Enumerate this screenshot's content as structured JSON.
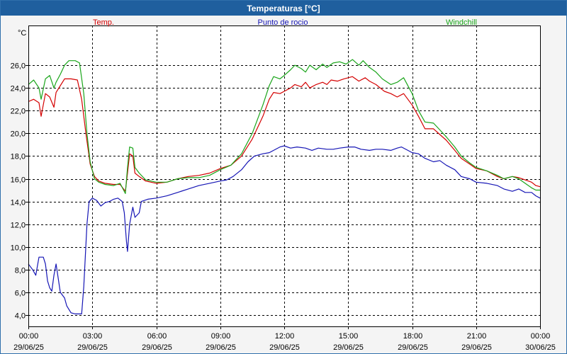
{
  "window": {
    "title": "Temperaturas [°C]"
  },
  "chart_data": {
    "type": "line",
    "title": "Temperaturas [°C]",
    "ylabel": "°C",
    "xlabel": "",
    "ylim": [
      3,
      29.5
    ],
    "yticks": [
      4,
      6,
      8,
      10,
      12,
      14,
      16,
      18,
      20,
      22,
      24,
      26
    ],
    "ytick_labels": [
      "4,0",
      "6,0",
      "8,0",
      "10,0",
      "12,0",
      "14,0",
      "16,0",
      "18,0",
      "20,0",
      "22,0",
      "24,0",
      "26,0"
    ],
    "xlim": [
      0,
      24
    ],
    "xticks": [
      0,
      3,
      6,
      9,
      12,
      15,
      18,
      21,
      24
    ],
    "xtick_labels": [
      {
        "time": "00:00",
        "date": "29/06/25"
      },
      {
        "time": "03:00",
        "date": "29/06/25"
      },
      {
        "time": "06:00",
        "date": "29/06/25"
      },
      {
        "time": "09:00",
        "date": "29/06/25"
      },
      {
        "time": "12:00",
        "date": "29/06/25"
      },
      {
        "time": "15:00",
        "date": "29/06/25"
      },
      {
        "time": "18:00",
        "date": "29/06/25"
      },
      {
        "time": "21:00",
        "date": "29/06/25"
      },
      {
        "time": "00:00",
        "date": "30/06/25"
      }
    ],
    "grid": true,
    "legend_position": "top",
    "x_unit": "hours",
    "series": [
      {
        "name": "Temp.",
        "color": "#d40000",
        "points": [
          [
            0,
            22.8
          ],
          [
            0.25,
            23.0
          ],
          [
            0.5,
            22.7
          ],
          [
            0.6,
            21.5
          ],
          [
            0.8,
            23.5
          ],
          [
            1.0,
            23.2
          ],
          [
            1.2,
            22.3
          ],
          [
            1.3,
            23.6
          ],
          [
            1.5,
            24.2
          ],
          [
            1.7,
            24.8
          ],
          [
            2.0,
            24.8
          ],
          [
            2.3,
            24.7
          ],
          [
            2.5,
            23.0
          ],
          [
            2.7,
            20.0
          ],
          [
            2.9,
            17.3
          ],
          [
            3.1,
            16.2
          ],
          [
            3.3,
            15.8
          ],
          [
            3.6,
            15.6
          ],
          [
            4.0,
            15.5
          ],
          [
            4.3,
            15.5
          ],
          [
            4.55,
            14.9
          ],
          [
            4.65,
            16.5
          ],
          [
            4.75,
            18.2
          ],
          [
            4.9,
            18.0
          ],
          [
            5.0,
            16.5
          ],
          [
            5.2,
            16.2
          ],
          [
            5.5,
            15.8
          ],
          [
            6.0,
            15.6
          ],
          [
            6.5,
            15.7
          ],
          [
            7.0,
            16.0
          ],
          [
            7.5,
            16.2
          ],
          [
            8.0,
            16.3
          ],
          [
            8.5,
            16.5
          ],
          [
            9.0,
            16.9
          ],
          [
            9.5,
            17.2
          ],
          [
            10.0,
            18.0
          ],
          [
            10.5,
            19.5
          ],
          [
            11.0,
            21.5
          ],
          [
            11.3,
            23.0
          ],
          [
            11.5,
            23.6
          ],
          [
            11.8,
            23.5
          ],
          [
            12.0,
            23.7
          ],
          [
            12.3,
            24.0
          ],
          [
            12.5,
            24.3
          ],
          [
            12.8,
            24.1
          ],
          [
            13.0,
            24.5
          ],
          [
            13.2,
            24.0
          ],
          [
            13.5,
            24.3
          ],
          [
            13.8,
            24.5
          ],
          [
            14.0,
            24.3
          ],
          [
            14.2,
            24.7
          ],
          [
            14.5,
            24.6
          ],
          [
            14.8,
            24.8
          ],
          [
            15.0,
            24.9
          ],
          [
            15.2,
            25.0
          ],
          [
            15.5,
            24.6
          ],
          [
            15.8,
            24.9
          ],
          [
            16.0,
            24.6
          ],
          [
            16.3,
            24.3
          ],
          [
            16.7,
            23.7
          ],
          [
            17.0,
            23.5
          ],
          [
            17.3,
            23.2
          ],
          [
            17.6,
            23.5
          ],
          [
            18.0,
            22.5
          ],
          [
            18.3,
            21.5
          ],
          [
            18.6,
            20.4
          ],
          [
            19.0,
            20.4
          ],
          [
            19.3,
            19.9
          ],
          [
            19.6,
            19.4
          ],
          [
            20.0,
            18.5
          ],
          [
            20.3,
            17.8
          ],
          [
            20.7,
            17.3
          ],
          [
            21.0,
            16.9
          ],
          [
            21.5,
            16.7
          ],
          [
            22.0,
            16.2
          ],
          [
            22.3,
            16.0
          ],
          [
            22.7,
            16.2
          ],
          [
            23.0,
            16.1
          ],
          [
            23.3,
            15.9
          ],
          [
            23.6,
            15.7
          ],
          [
            23.8,
            15.4
          ],
          [
            24.0,
            15.3
          ]
        ]
      },
      {
        "name": "Punto de rocio",
        "color": "#1515b5",
        "points": [
          [
            0,
            8.5
          ],
          [
            0.2,
            8.0
          ],
          [
            0.35,
            7.5
          ],
          [
            0.5,
            9.1
          ],
          [
            0.7,
            9.1
          ],
          [
            0.8,
            8.5
          ],
          [
            0.9,
            7.0
          ],
          [
            1.0,
            6.4
          ],
          [
            1.1,
            6.1
          ],
          [
            1.2,
            7.5
          ],
          [
            1.3,
            8.5
          ],
          [
            1.5,
            6.0
          ],
          [
            1.7,
            5.5
          ],
          [
            1.8,
            4.8
          ],
          [
            2.0,
            4.2
          ],
          [
            2.2,
            4.1
          ],
          [
            2.5,
            4.1
          ],
          [
            2.6,
            6.5
          ],
          [
            2.75,
            12.0
          ],
          [
            2.85,
            14.0
          ],
          [
            3.0,
            14.3
          ],
          [
            3.2,
            14.1
          ],
          [
            3.4,
            13.6
          ],
          [
            3.6,
            13.9
          ],
          [
            3.8,
            14.0
          ],
          [
            4.0,
            14.2
          ],
          [
            4.2,
            14.3
          ],
          [
            4.4,
            14.0
          ],
          [
            4.5,
            13.0
          ],
          [
            4.6,
            10.5
          ],
          [
            4.65,
            9.6
          ],
          [
            4.75,
            12.0
          ],
          [
            4.9,
            13.5
          ],
          [
            5.0,
            12.6
          ],
          [
            5.2,
            13.0
          ],
          [
            5.3,
            14.0
          ],
          [
            5.6,
            14.2
          ],
          [
            6.0,
            14.3
          ],
          [
            6.5,
            14.5
          ],
          [
            7.0,
            14.8
          ],
          [
            7.5,
            15.1
          ],
          [
            8.0,
            15.4
          ],
          [
            8.5,
            15.6
          ],
          [
            9.0,
            15.8
          ],
          [
            9.3,
            15.9
          ],
          [
            9.6,
            16.2
          ],
          [
            10.0,
            16.8
          ],
          [
            10.3,
            17.5
          ],
          [
            10.6,
            18.0
          ],
          [
            11.0,
            18.2
          ],
          [
            11.3,
            18.3
          ],
          [
            11.5,
            18.5
          ],
          [
            11.8,
            18.8
          ],
          [
            12.0,
            18.9
          ],
          [
            12.3,
            18.7
          ],
          [
            12.6,
            18.8
          ],
          [
            13.0,
            18.7
          ],
          [
            13.3,
            18.5
          ],
          [
            13.6,
            18.7
          ],
          [
            14.0,
            18.6
          ],
          [
            14.3,
            18.6
          ],
          [
            14.6,
            18.7
          ],
          [
            15.0,
            18.8
          ],
          [
            15.3,
            18.8
          ],
          [
            15.6,
            18.6
          ],
          [
            16.0,
            18.5
          ],
          [
            16.3,
            18.6
          ],
          [
            16.6,
            18.6
          ],
          [
            17.0,
            18.5
          ],
          [
            17.3,
            18.7
          ],
          [
            17.5,
            18.8
          ],
          [
            17.8,
            18.5
          ],
          [
            18.0,
            18.3
          ],
          [
            18.3,
            18.2
          ],
          [
            18.6,
            17.8
          ],
          [
            19.0,
            17.5
          ],
          [
            19.3,
            17.6
          ],
          [
            19.6,
            17.2
          ],
          [
            20.0,
            16.8
          ],
          [
            20.3,
            16.2
          ],
          [
            20.7,
            16.0
          ],
          [
            21.0,
            15.7
          ],
          [
            21.5,
            15.6
          ],
          [
            22.0,
            15.4
          ],
          [
            22.3,
            15.1
          ],
          [
            22.7,
            14.9
          ],
          [
            23.0,
            15.1
          ],
          [
            23.3,
            14.8
          ],
          [
            23.6,
            14.8
          ],
          [
            23.8,
            14.5
          ],
          [
            24.0,
            14.3
          ]
        ]
      },
      {
        "name": "Windchill",
        "color": "#1aa51a",
        "points": [
          [
            0,
            24.3
          ],
          [
            0.25,
            24.7
          ],
          [
            0.5,
            24.0
          ],
          [
            0.6,
            23.0
          ],
          [
            0.8,
            24.8
          ],
          [
            1.0,
            25.1
          ],
          [
            1.2,
            24.0
          ],
          [
            1.3,
            24.5
          ],
          [
            1.5,
            25.2
          ],
          [
            1.7,
            26.0
          ],
          [
            1.9,
            26.4
          ],
          [
            2.2,
            26.4
          ],
          [
            2.4,
            26.2
          ],
          [
            2.6,
            23.5
          ],
          [
            2.75,
            20.0
          ],
          [
            2.9,
            17.5
          ],
          [
            3.1,
            16.0
          ],
          [
            3.3,
            15.7
          ],
          [
            3.6,
            15.5
          ],
          [
            4.0,
            15.4
          ],
          [
            4.3,
            15.6
          ],
          [
            4.55,
            14.7
          ],
          [
            4.65,
            17.0
          ],
          [
            4.75,
            18.8
          ],
          [
            4.9,
            18.7
          ],
          [
            5.0,
            17.0
          ],
          [
            5.2,
            16.5
          ],
          [
            5.5,
            15.9
          ],
          [
            6.0,
            15.7
          ],
          [
            6.5,
            15.7
          ],
          [
            7.0,
            16.0
          ],
          [
            7.5,
            16.1
          ],
          [
            8.0,
            16.1
          ],
          [
            8.5,
            16.3
          ],
          [
            9.0,
            16.8
          ],
          [
            9.5,
            17.2
          ],
          [
            10.0,
            18.2
          ],
          [
            10.5,
            20.0
          ],
          [
            11.0,
            22.5
          ],
          [
            11.3,
            24.2
          ],
          [
            11.5,
            25.0
          ],
          [
            11.8,
            24.8
          ],
          [
            12.0,
            25.1
          ],
          [
            12.3,
            25.6
          ],
          [
            12.5,
            26.0
          ],
          [
            12.8,
            25.7
          ],
          [
            13.0,
            25.4
          ],
          [
            13.2,
            26.0
          ],
          [
            13.5,
            25.6
          ],
          [
            13.8,
            26.1
          ],
          [
            14.0,
            25.8
          ],
          [
            14.3,
            26.2
          ],
          [
            14.6,
            26.3
          ],
          [
            14.9,
            26.1
          ],
          [
            15.2,
            26.5
          ],
          [
            15.5,
            26.0
          ],
          [
            15.7,
            26.4
          ],
          [
            16.0,
            25.8
          ],
          [
            16.3,
            25.4
          ],
          [
            16.6,
            24.8
          ],
          [
            17.0,
            24.3
          ],
          [
            17.3,
            24.5
          ],
          [
            17.6,
            24.9
          ],
          [
            18.0,
            23.5
          ],
          [
            18.3,
            22.0
          ],
          [
            18.6,
            21.0
          ],
          [
            19.0,
            20.9
          ],
          [
            19.3,
            20.3
          ],
          [
            19.6,
            19.7
          ],
          [
            20.0,
            18.8
          ],
          [
            20.3,
            18.0
          ],
          [
            20.7,
            17.4
          ],
          [
            21.0,
            17.0
          ],
          [
            21.5,
            16.7
          ],
          [
            22.0,
            16.3
          ],
          [
            22.3,
            16.0
          ],
          [
            22.7,
            16.2
          ],
          [
            23.0,
            16.0
          ],
          [
            23.3,
            15.6
          ],
          [
            23.6,
            15.2
          ],
          [
            23.8,
            15.0
          ],
          [
            24.0,
            15.0
          ]
        ]
      }
    ]
  }
}
